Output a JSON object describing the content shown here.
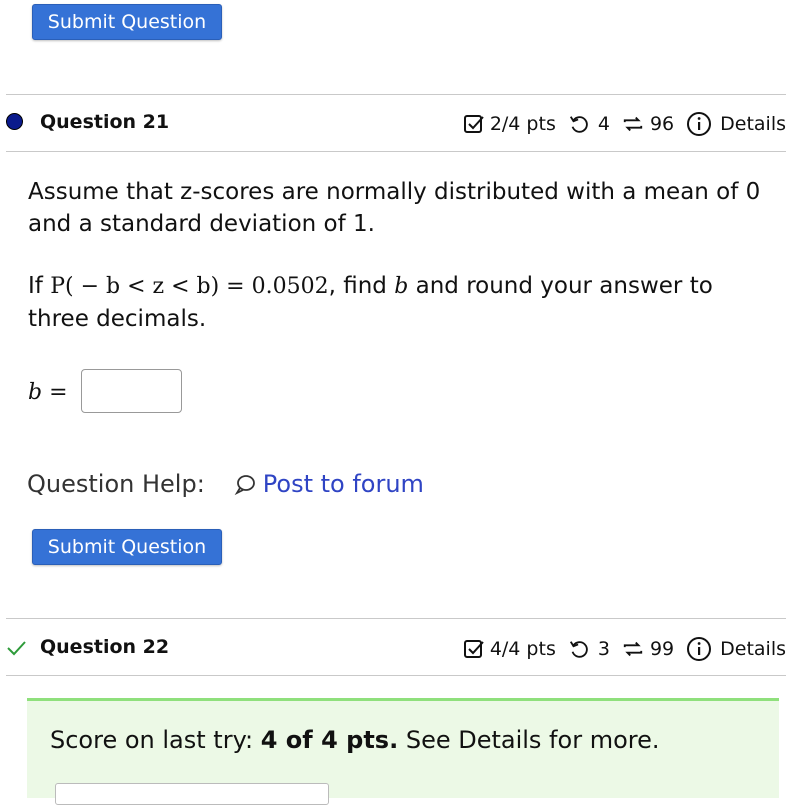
{
  "top_submit": {
    "label": "Submit Question"
  },
  "q21": {
    "title": "Question 21",
    "points": "2/4 pts",
    "retries": "4",
    "attempts": "96",
    "details": "Details"
  },
  "problem": {
    "line1": "Assume that z-scores are normally distributed with a mean of 0 and a standard deviation of 1.",
    "if_word": "If",
    "expression": "P( − b < z < b) = 0.0502",
    "after_expr": ", find",
    "var_b": "b",
    "rest": "and round your answer to three decimals.",
    "answer_label": "b =",
    "answer_value": ""
  },
  "help": {
    "label": "Question Help:",
    "forum": "Post to forum"
  },
  "q21_submit": {
    "label": "Submit Question"
  },
  "q22": {
    "title": "Question 22",
    "points": "4/4 pts",
    "retries": "3",
    "attempts": "99",
    "details": "Details"
  },
  "score": {
    "prefix": "Score on last try: ",
    "value": "4 of 4 pts.",
    "suffix": " See Details for more."
  }
}
